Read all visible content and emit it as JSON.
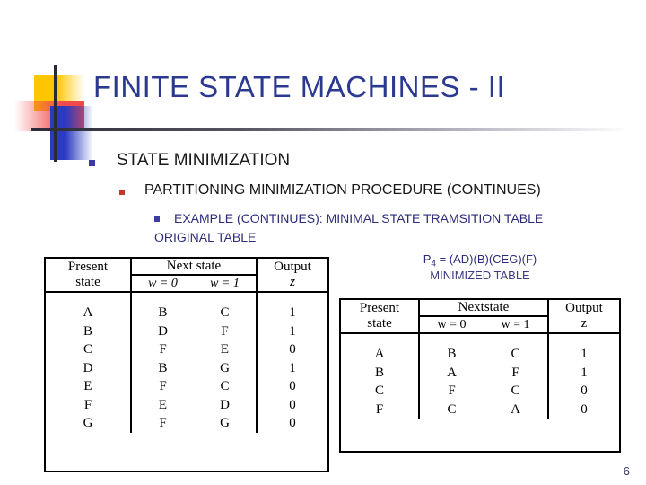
{
  "slide": {
    "title": "FINITE STATE MACHINES - II",
    "page_number": "6",
    "title_color": "#2B3990",
    "accent_colors": {
      "yellow": "#FFC600",
      "red": "#F04A4A",
      "blue": "#2B3BC0",
      "rule": "#2B2B38"
    }
  },
  "outline": {
    "level1": {
      "bullet": "square-bullet-icon",
      "text": "STATE MINIMIZATION",
      "color": "#1a1a1a"
    },
    "level2": {
      "bullet": "square-bullet-icon",
      "text": "PARTITIONING MINIMIZATION PROCEDURE (CONTINUES)",
      "color": "#161616"
    },
    "level3": {
      "bullet": "square-bullet-icon",
      "text": "EXAMPLE (CONTINUES): MINIMAL STATE TRAMSITION TABLE",
      "color": "#2B2B7A"
    },
    "level3_continued": "ORIGINAL TABLE"
  },
  "original_table": {
    "headers": {
      "present_state_line1": "Present",
      "present_state_line2": "state",
      "next_state": "Next state",
      "w0": "w = 0",
      "w1": "w = 1",
      "output_line1": "Output",
      "output_line2": "z"
    },
    "rows": [
      {
        "present": "A",
        "w0": "B",
        "w1": "C",
        "z": "1"
      },
      {
        "present": "B",
        "w0": "D",
        "w1": "F",
        "z": "1"
      },
      {
        "present": "C",
        "w0": "F",
        "w1": "E",
        "z": "0"
      },
      {
        "present": "D",
        "w0": "B",
        "w1": "G",
        "z": "1"
      },
      {
        "present": "E",
        "w0": "F",
        "w1": "C",
        "z": "0"
      },
      {
        "present": "F",
        "w0": "E",
        "w1": "D",
        "z": "0"
      },
      {
        "present": "G",
        "w0": "F",
        "w1": "G",
        "z": "0"
      }
    ]
  },
  "minimized_table": {
    "caption_equation_prefix": "P",
    "caption_equation_sub": "4",
    "caption_equation_rest": " = (AD)(B)(CEG)(F)",
    "caption_subtitle": "MINIMIZED TABLE",
    "headers": {
      "present_state_line1": "Present",
      "present_state_line2": "state",
      "next_state": "Nextstate",
      "w0": "w = 0",
      "w1": "w = 1",
      "output_line1": "Output",
      "output_line2": "z"
    },
    "rows": [
      {
        "present": "A",
        "w0": "B",
        "w1": "C",
        "z": "1"
      },
      {
        "present": "B",
        "w0": "A",
        "w1": "F",
        "z": "1"
      },
      {
        "present": "C",
        "w0": "F",
        "w1": "C",
        "z": "0"
      },
      {
        "present": "F",
        "w0": "C",
        "w1": "A",
        "z": "0"
      }
    ]
  }
}
